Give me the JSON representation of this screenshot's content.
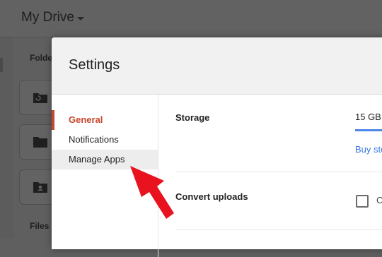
{
  "drive": {
    "title": "My Drive",
    "folders_label": "Folde",
    "files_label": "Files"
  },
  "settings": {
    "title": "Settings",
    "nav": [
      {
        "label": "General",
        "state": "active"
      },
      {
        "label": "Notifications",
        "state": "normal"
      },
      {
        "label": "Manage Apps",
        "state": "hover"
      }
    ],
    "storage": {
      "label": "Storage",
      "value": "15 GB",
      "buy_link": "Buy sto"
    },
    "convert": {
      "label": "Convert uploads",
      "checkbox_text": "C",
      "checked": false
    }
  },
  "colors": {
    "accent_red": "#c5472e",
    "link_blue": "#3b78e7",
    "arrow_red": "#e8131e"
  }
}
